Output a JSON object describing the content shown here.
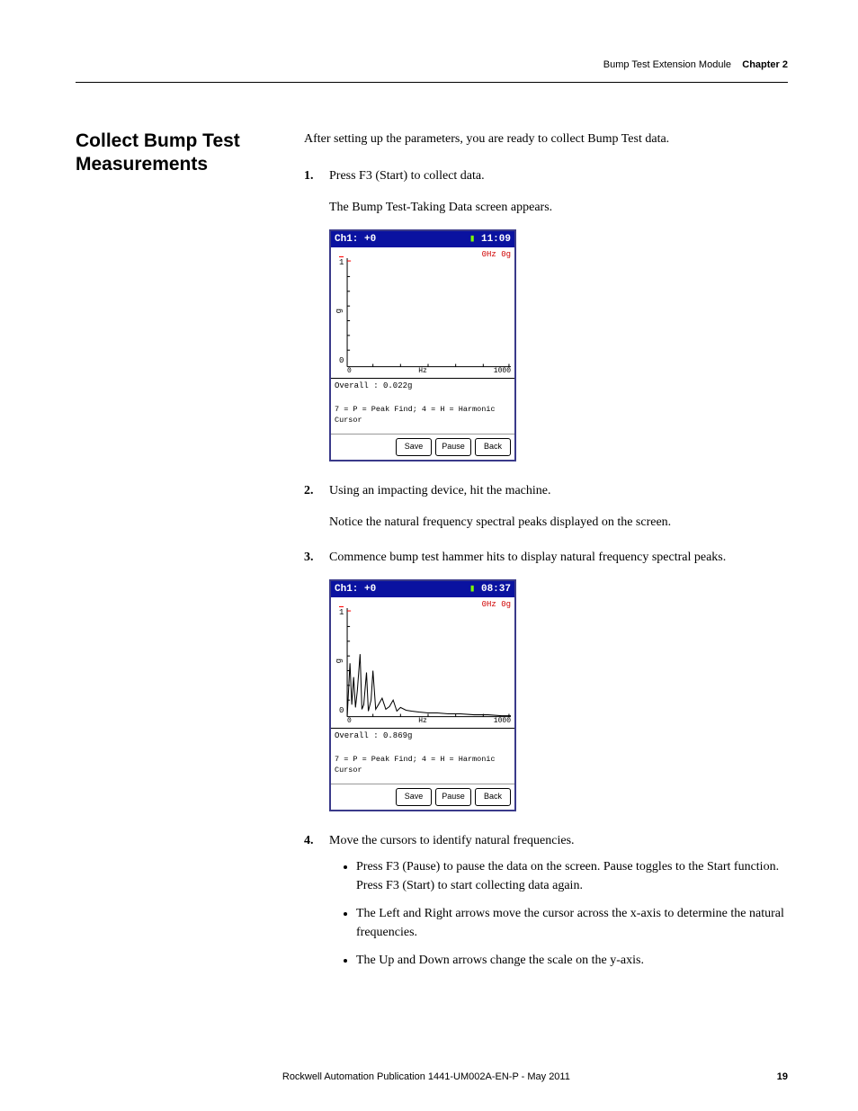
{
  "header": {
    "chapter_name": "Bump Test Extension Module",
    "chapter_label": "Chapter 2"
  },
  "title": "Collect Bump Test Measurements",
  "intro": "After setting up the parameters, you are ready to collect Bump Test data.",
  "steps": [
    {
      "text": "Press F3 (Start) to collect data.",
      "body": "The Bump Test-Taking Data screen appears.",
      "screenshot": {
        "header_left": "Ch1: +0",
        "time": "11:09",
        "cursor_readout": "0Hz  0g",
        "y_top": "1",
        "y_unit": "g",
        "y_bottom": "0",
        "x_min": "0",
        "x_label": "Hz",
        "x_max": "1000",
        "overall": "Overall  : 0.022g",
        "hint": "7 = P = Peak Find; 4 = H = Harmonic Cursor",
        "buttons": [
          "Save",
          "Pause",
          "Back"
        ],
        "has_peaks": false
      }
    },
    {
      "text": "Using an impacting device, hit the machine.",
      "body": "Notice the natural frequency spectral peaks displayed on the screen."
    },
    {
      "text": "Commence bump test hammer hits to display natural frequency spectral peaks.",
      "screenshot": {
        "header_left": "Ch1: +0",
        "time": "08:37",
        "cursor_readout": "0Hz  0g",
        "y_top": "1",
        "y_unit": "g",
        "y_bottom": "0",
        "x_min": "0",
        "x_label": "Hz",
        "x_max": "1000",
        "overall": "Overall  : 0.869g",
        "hint": "7 = P = Peak Find; 4 = H = Harmonic Cursor",
        "buttons": [
          "Save",
          "Pause",
          "Back"
        ],
        "has_peaks": true
      }
    },
    {
      "text": "Move the cursors to identify natural frequencies.",
      "sub": [
        "Press F3 (Pause) to pause the data on the screen. Pause toggles to the Start function. Press F3 (Start) to start collecting data again.",
        "The Left and Right arrows move the cursor across the x-axis to determine the natural frequencies.",
        "The Up and Down arrows change the scale on the y-axis."
      ]
    }
  ],
  "footer": {
    "publication": "Rockwell Automation Publication 1441-UM002A-EN-P - May 2011",
    "page": "19"
  }
}
